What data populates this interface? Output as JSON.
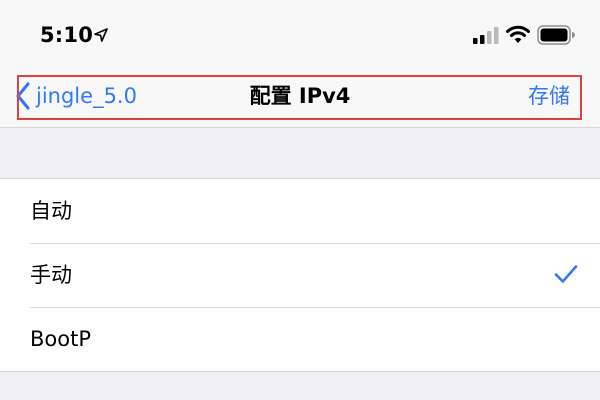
{
  "status_bar": {
    "time": "5:10",
    "icons": [
      "location-arrow-icon",
      "signal-icon",
      "wifi-icon",
      "battery-icon"
    ]
  },
  "nav_bar": {
    "back_label": "jingle_5.0",
    "title": "配置 IPv4",
    "save_label": "存储"
  },
  "options": [
    {
      "label": "自动",
      "selected": false
    },
    {
      "label": "手动",
      "selected": true
    },
    {
      "label": "BootP",
      "selected": false
    }
  ],
  "colors": {
    "accent": "#3478f6",
    "highlight": "#e0403e",
    "background": "#efeff4"
  }
}
